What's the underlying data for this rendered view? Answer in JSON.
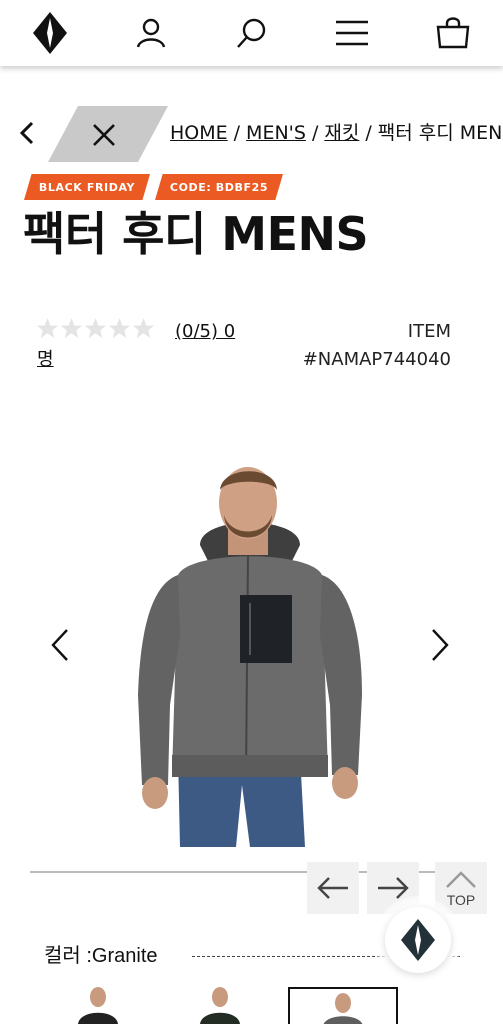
{
  "header": {
    "icons": [
      "logo-icon",
      "user-icon",
      "search-icon",
      "menu-icon",
      "cart-icon"
    ]
  },
  "breadcrumb": {
    "home": "HOME",
    "sep": "/",
    "mens": "MEN'S",
    "jackets": "재킷",
    "current": "팩터 후디 MENS"
  },
  "badges": {
    "black_friday": "BLACK FRIDAY",
    "code": "CODE: BDBF25"
  },
  "product": {
    "title": "팩터 후디 MENS",
    "rating": 0,
    "rating_max": 5,
    "reviews_text": "(0/5) 0",
    "reviews_suffix": "명",
    "item_label": "ITEM",
    "item_code": "#NAMAP744040"
  },
  "controls": {
    "top_label": "TOP"
  },
  "options": {
    "color_label": "컬러 :Granite"
  },
  "colors": {
    "accent": "#ec5a24",
    "gray_tab": "#c9c9c9",
    "jacket": "#6b6b6b"
  }
}
